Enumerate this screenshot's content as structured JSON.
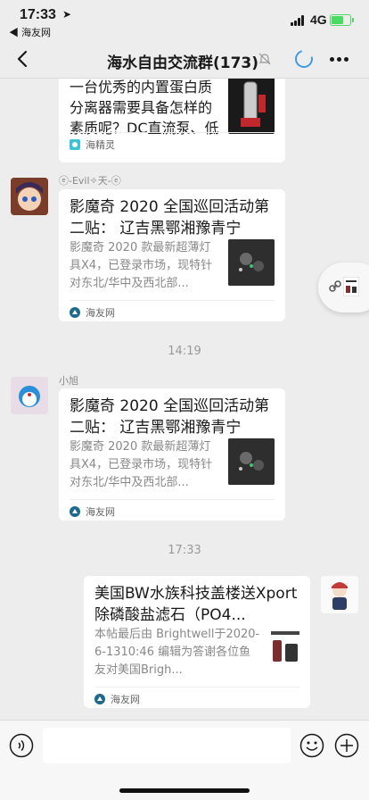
{
  "status": {
    "time": "17:33",
    "back_app": "◀ 海友网",
    "network": "4G"
  },
  "nav": {
    "title": "海水自由交流群(173)"
  },
  "messages": [
    {
      "title_partial": "一台优秀的内置蛋白质分离器需要具备怎样的素质呢？DC直流泵、低电压...",
      "source": "海精灵"
    },
    {
      "sender": "ⓔ-Evil✧天-ⓔ",
      "title": "影魔奇 2020 全国巡回活动第二贴： 辽吉黑鄂湘豫青宁",
      "desc": "影魔奇 2020 款最新超薄灯具X4，已登录市场，现特针对东北/华中及西北部...",
      "source": "海友网"
    },
    {
      "sender": "小旭",
      "title": "影魔奇 2020 全国巡回活动第二贴： 辽吉黑鄂湘豫青宁",
      "desc": "影魔奇 2020 款最新超薄灯具X4，已登录市场，现特针对东北/华中及西北部...",
      "source": "海友网"
    },
    {
      "title": "美国BW水族科技盖楼送Xport除磷酸盐滤石（PO4...",
      "desc": "本帖最后由 Brightwell于2020-6-1310:46 编辑为答谢各位鱼友对美国Brigh...",
      "source": "海友网"
    }
  ],
  "timestamps": [
    "14:19",
    "17:33"
  ],
  "colors": {
    "background": "#ededed",
    "accent": "#3c9ae8",
    "battery": "#4cd964"
  }
}
